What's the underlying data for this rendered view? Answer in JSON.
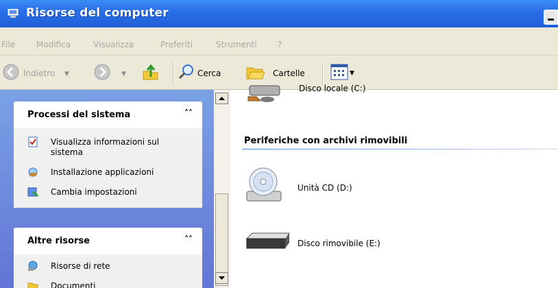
{
  "window": {
    "title": "Risorse del computer"
  },
  "menu": [
    "File",
    "Modifica",
    "Visualizza",
    "Preferiti",
    "Strumenti",
    "?"
  ],
  "toolbar": {
    "back_label": "Indietro",
    "search_label": "Cerca",
    "folders_label": "Cartelle"
  },
  "system_tasks": {
    "title": "Processi del sistema",
    "items": [
      {
        "line1": "Visualizza informazioni sul",
        "line2": "sistema"
      },
      {
        "line1": "Installazione applicazioni"
      },
      {
        "line1": "Cambia impostazioni"
      }
    ]
  },
  "other_places": {
    "title": "Altre risorse",
    "items": [
      "Risorse di rete",
      "Documenti"
    ]
  },
  "main": {
    "partial_drive": "Disco locale (C:)",
    "group_title": "Periferiche con archivi rimovibili",
    "drives": [
      "Unità CD (D:)",
      "Disco rimovibile (E:)"
    ]
  },
  "colors": {
    "title_bar": "#2a6fe8",
    "task_pane": "#6d8fe0",
    "menu_bg": "#ece9d8"
  }
}
